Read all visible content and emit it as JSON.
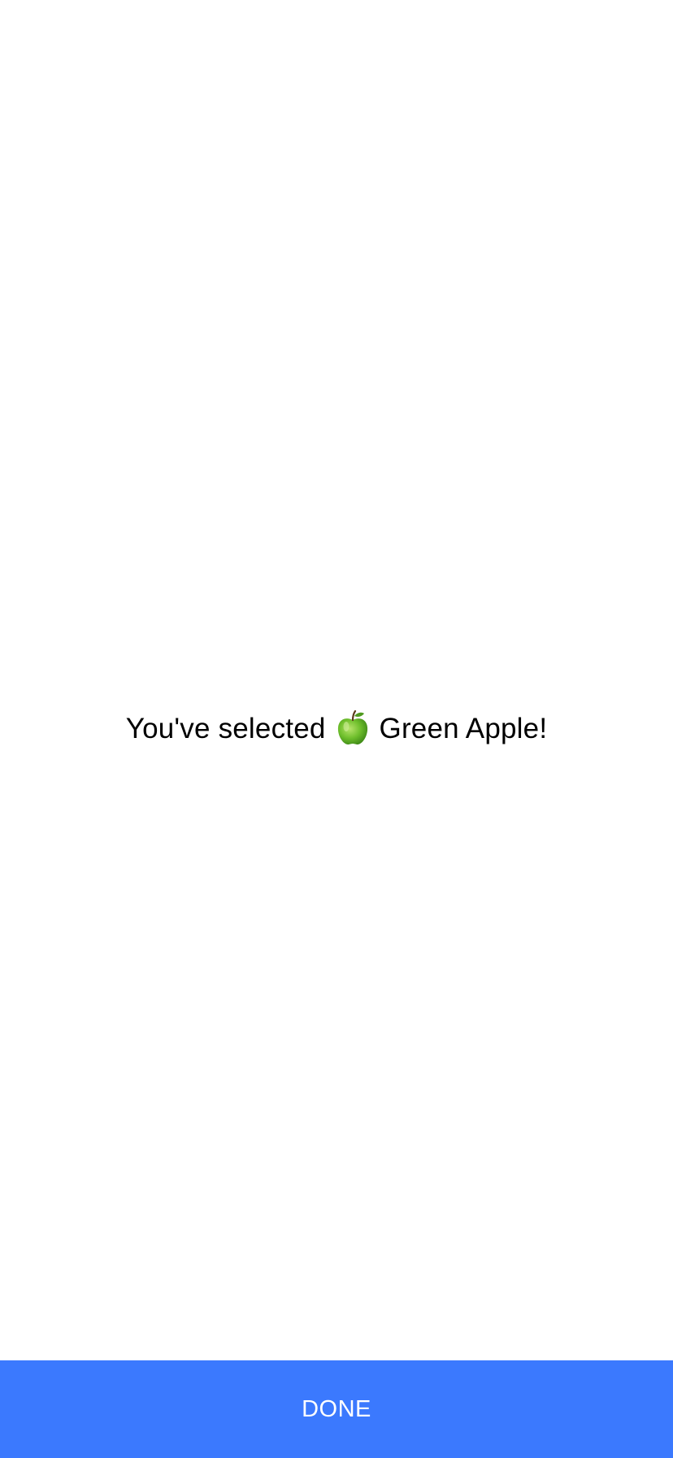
{
  "message": {
    "prefix": "You've selected",
    "icon": "green-apple-icon",
    "suffix": "Green Apple!"
  },
  "done_button": {
    "label": "DONE",
    "color": "#3b79fe"
  }
}
